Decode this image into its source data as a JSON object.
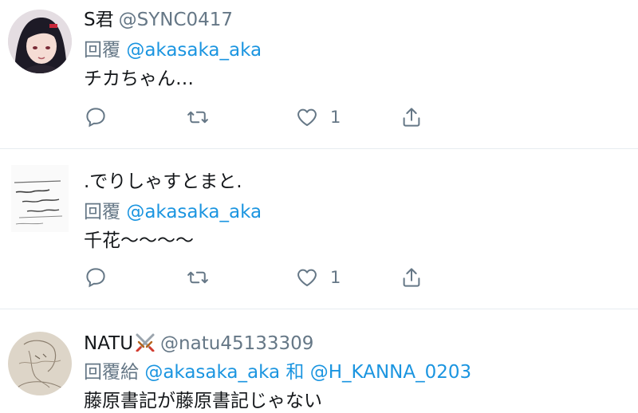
{
  "tweets": [
    {
      "name": "S君",
      "handle": "@SYNC0417",
      "reply_prefix": "回覆",
      "mentions": [
        "@akasaka_aka"
      ],
      "joiner": "",
      "text": "チカちゃん…",
      "like_count": "1",
      "avatar_icon": "anime-girl-avatar"
    },
    {
      "name": ".でりしゃすとまと.",
      "handle": "",
      "reply_prefix": "回覆",
      "mentions": [
        "@akasaka_aka"
      ],
      "joiner": "",
      "text": "千花～～～～",
      "like_count": "1",
      "avatar_icon": "handwritten-note-avatar"
    },
    {
      "name": "NATU",
      "name_emoji": "crossed-swords-icon",
      "handle": "@natu45133309",
      "reply_prefix": "回覆給",
      "mentions": [
        "@akasaka_aka",
        "@H_KANNA_0203"
      ],
      "joiner": "和",
      "text": "藤原書記が藤原書記じゃない",
      "like_count": "",
      "avatar_icon": "sketch-drawing-avatar"
    }
  ],
  "colors": {
    "mention": "#1b95e0",
    "secondary": "#657786",
    "divider": "#e6ecf0",
    "icon": "#657786"
  }
}
